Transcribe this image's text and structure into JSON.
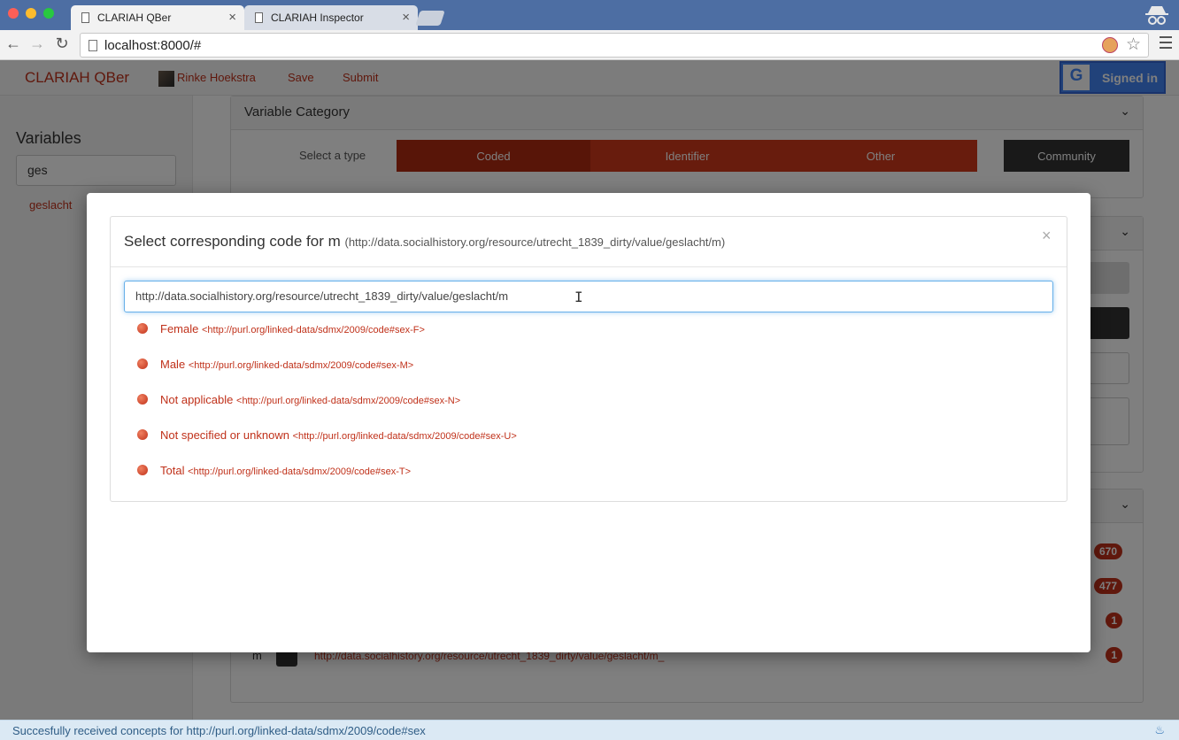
{
  "browser": {
    "tabs": [
      {
        "title": "CLARIAH QBer",
        "active": true
      },
      {
        "title": "CLARIAH Inspector",
        "active": false
      }
    ],
    "url": "localhost:8000/#"
  },
  "navbar": {
    "brand": "CLARIAH QBer",
    "user": "Rinke Hoekstra",
    "save": "Save",
    "submit": "Submit",
    "signed_in": "Signed in",
    "google_letter": "G"
  },
  "sidebar": {
    "title": "Variables",
    "search_value": "ges",
    "items": [
      "geslacht"
    ]
  },
  "panel": {
    "title": "Variable Category",
    "select_label": "Select a type",
    "types": [
      "Coded",
      "Identifier",
      "Other"
    ],
    "community": "Community"
  },
  "background": {
    "badges": [
      "670",
      "477",
      "1",
      "1"
    ],
    "row_label": "m",
    "row_link": "http://data.socialhistory.org/resource/utrecht_1839_dirty/value/geslacht/m_"
  },
  "modal": {
    "title": "Select corresponding code for m",
    "title_uri": "(http://data.socialhistory.org/resource/utrecht_1839_dirty/value/geslacht/m)",
    "close": "×",
    "input_value": "http://data.socialhistory.org/resource/utrecht_1839_dirty/value/geslacht/m",
    "suggestions": [
      {
        "label": "Female",
        "uri": "<http://purl.org/linked-data/sdmx/2009/code#sex-F>"
      },
      {
        "label": "Male",
        "uri": "<http://purl.org/linked-data/sdmx/2009/code#sex-M>"
      },
      {
        "label": "Not applicable",
        "uri": "<http://purl.org/linked-data/sdmx/2009/code#sex-N>"
      },
      {
        "label": "Not specified or unknown",
        "uri": "<http://purl.org/linked-data/sdmx/2009/code#sex-U>"
      },
      {
        "label": "Total",
        "uri": "<http://purl.org/linked-data/sdmx/2009/code#sex-T>"
      }
    ]
  },
  "status": {
    "message": "Succesfully received concepts for http://purl.org/linked-data/sdmx/2009/code#sex"
  }
}
